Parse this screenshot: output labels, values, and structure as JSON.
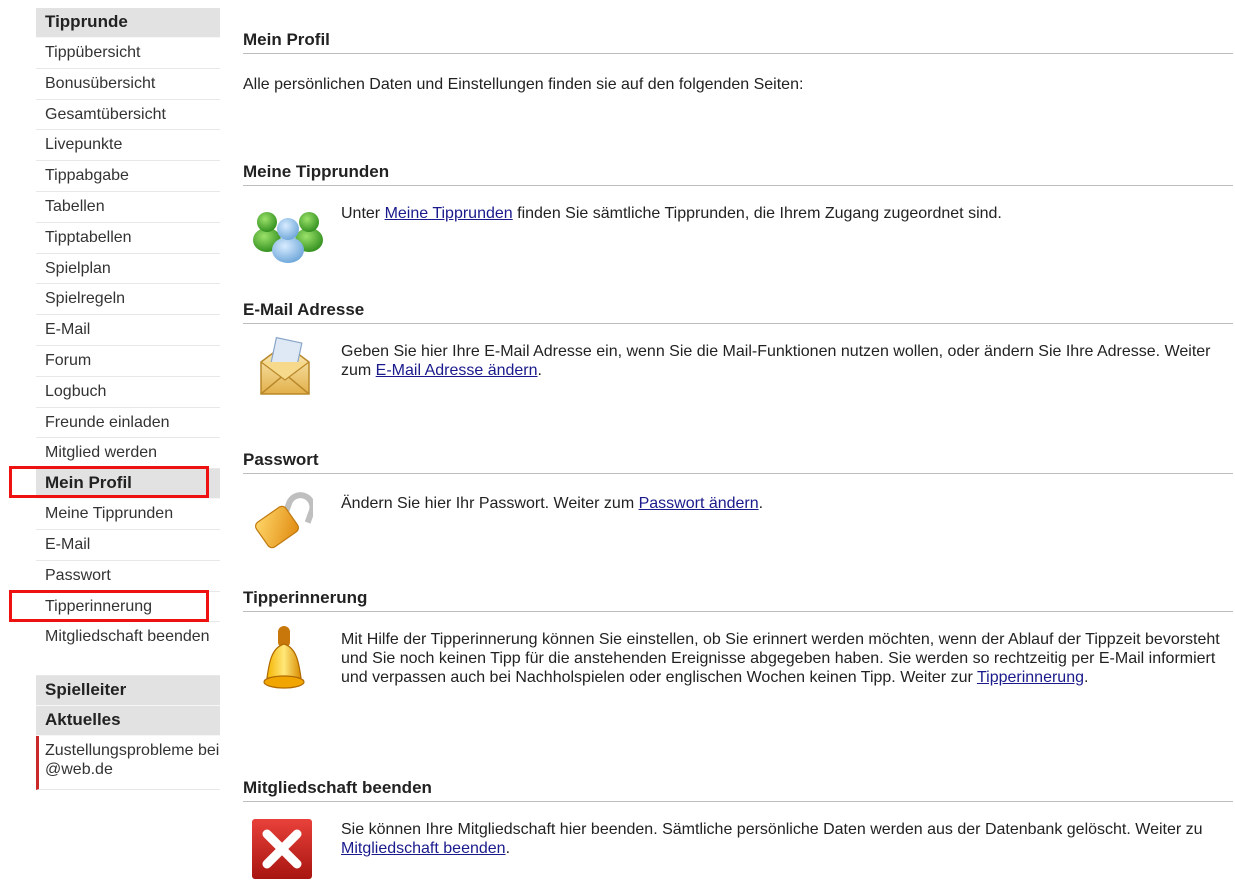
{
  "sidebar": {
    "groups": [
      {
        "title": "Tipprunde",
        "items": [
          "Tippübersicht",
          "Bonusübersicht",
          "Gesamtübersicht",
          "Livepunkte",
          "Tippabgabe",
          "Tabellen",
          "Tipptabellen",
          "Spielplan",
          "Spielregeln",
          "E-Mail",
          "Forum",
          "Logbuch",
          "Freunde einladen",
          "Mitglied werden"
        ]
      },
      {
        "title": "Mein Profil",
        "items": [
          "Meine Tipprunden",
          "E-Mail",
          "Passwort",
          "Tipperinnerung",
          "Mitgliedschaft beenden"
        ]
      },
      {
        "title": "Spielleiter",
        "items": []
      },
      {
        "title": "Aktuelles",
        "items": [
          "Zustellungsprobleme bei @web.de"
        ]
      }
    ]
  },
  "main": {
    "profile": {
      "title": "Mein Profil",
      "intro": "Alle persönlichen Daten und Einstellungen finden sie auf den folgenden Seiten:"
    },
    "tipprunden": {
      "title": "Meine Tipprunden",
      "text_before": "Unter ",
      "link": "Meine Tipprunden",
      "text_after": " finden Sie sämtliche Tipprunden, die Ihrem Zugang zugeordnet sind."
    },
    "email": {
      "title": "E-Mail Adresse",
      "text_before": "Geben Sie hier Ihre E-Mail Adresse ein, wenn Sie die Mail-Funktionen nutzen wollen, oder ändern Sie Ihre Adresse. Weiter zum ",
      "link": "E-Mail Adresse ändern",
      "text_after": "."
    },
    "passwort": {
      "title": "Passwort",
      "text_before": "Ändern Sie hier Ihr Passwort. Weiter zum ",
      "link": "Passwort ändern",
      "text_after": "."
    },
    "erinnerung": {
      "title": "Tipperinnerung",
      "text_before": "Mit Hilfe der Tipperinnerung können Sie einstellen, ob Sie erinnert werden möchten, wenn der Ablauf der Tippzeit bevorsteht und Sie noch keinen Tipp für die anstehenden Ereignisse abgegeben haben. Sie werden so rechtzeitig per E-Mail informiert und verpassen auch bei Nachholspielen oder englischen Wochen keinen Tipp. Weiter zur ",
      "link": "Tipperinnerung",
      "text_after": "."
    },
    "beenden": {
      "title": "Mitgliedschaft beenden",
      "text_before": "Sie können Ihre Mitgliedschaft hier beenden. Sämtliche persönliche Daten werden aus der Datenbank gelöscht. Weiter zu ",
      "link": "Mitgliedschaft beenden",
      "text_after": "."
    }
  }
}
